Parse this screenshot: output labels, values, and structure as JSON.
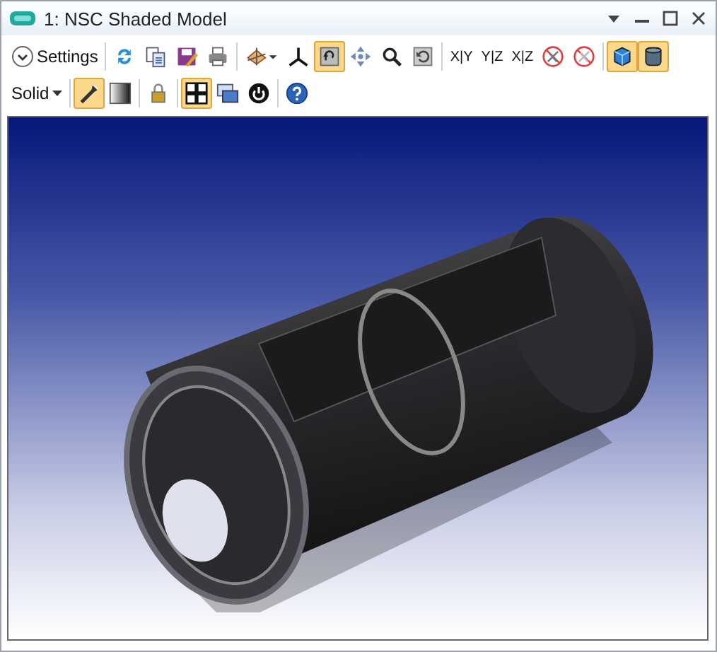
{
  "window": {
    "title": "1: NSC Shaded Model"
  },
  "toolbar_rows": [
    [
      {
        "kind": "dropdown",
        "label": "Settings",
        "selected": false
      },
      {
        "kind": "separator"
      },
      {
        "kind": "refresh",
        "selected": false
      },
      {
        "kind": "copy",
        "selected": false
      },
      {
        "kind": "save",
        "selected": false
      },
      {
        "kind": "print",
        "selected": false
      },
      {
        "kind": "separator"
      },
      {
        "kind": "axes-menu",
        "selected": false
      },
      {
        "kind": "axes",
        "selected": false
      },
      {
        "kind": "rotate",
        "selected": true
      },
      {
        "kind": "pan",
        "selected": false
      },
      {
        "kind": "zoom",
        "selected": false
      },
      {
        "kind": "reset",
        "selected": false
      },
      {
        "kind": "separator"
      },
      {
        "kind": "text",
        "label": "X|Y",
        "selected": false
      },
      {
        "kind": "text",
        "label": "Y|Z",
        "selected": false
      },
      {
        "kind": "text",
        "label": "X|Z",
        "selected": false
      },
      {
        "kind": "no-tool",
        "selected": false
      },
      {
        "kind": "no-scissors",
        "selected": false
      },
      {
        "kind": "separator"
      },
      {
        "kind": "cube",
        "selected": true
      },
      {
        "kind": "cylinder",
        "selected": true
      }
    ],
    [
      {
        "kind": "menu",
        "label": "Solid",
        "selected": false
      },
      {
        "kind": "separator"
      },
      {
        "kind": "flashlight",
        "selected": true
      },
      {
        "kind": "gradient",
        "selected": false
      },
      {
        "kind": "separator"
      },
      {
        "kind": "lock",
        "selected": false
      },
      {
        "kind": "separator"
      },
      {
        "kind": "fit",
        "selected": true
      },
      {
        "kind": "window",
        "selected": false
      },
      {
        "kind": "power",
        "selected": false
      },
      {
        "kind": "separator"
      },
      {
        "kind": "help",
        "selected": false
      }
    ]
  ]
}
